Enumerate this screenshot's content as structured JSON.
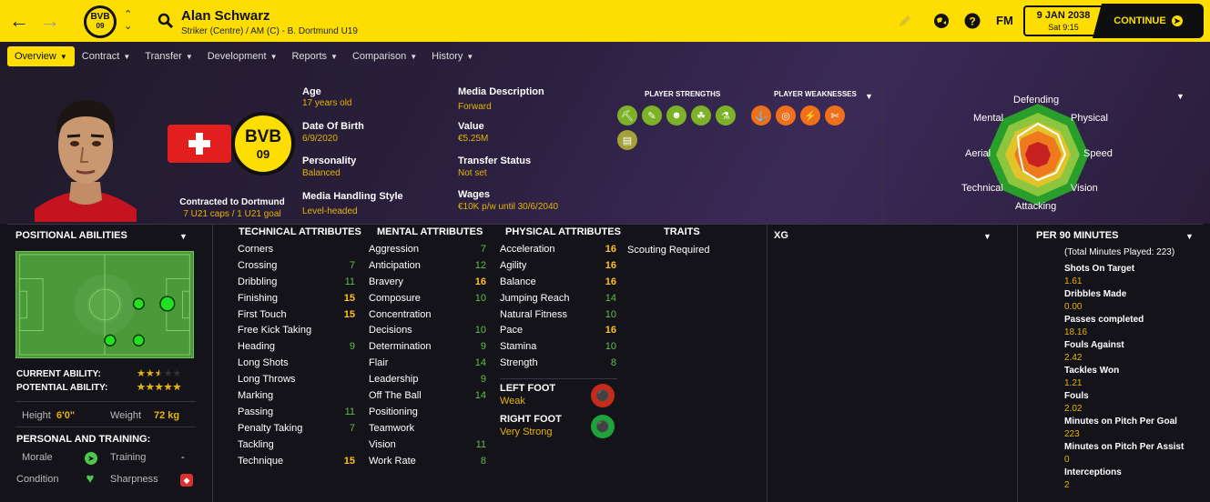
{
  "player": {
    "name": "Alan Schwarz",
    "subtitle": "Striker (Centre) / AM (C) - B. Dortmund U19"
  },
  "club_badge": {
    "top": "BVB",
    "bottom": "09"
  },
  "topbar": {
    "date": "9 JAN 2038",
    "time": "Sat 9:15",
    "continue_label": "CONTINUE",
    "fm_label": "FM"
  },
  "tabs": [
    {
      "label": "Overview"
    },
    {
      "label": "Contract"
    },
    {
      "label": "Transfer"
    },
    {
      "label": "Development"
    },
    {
      "label": "Reports"
    },
    {
      "label": "Comparison"
    },
    {
      "label": "History"
    }
  ],
  "contract": {
    "line1": "Contracted to Dortmund",
    "line2": "7 U21 caps / 1 U21 goal"
  },
  "info": {
    "age_label": "Age",
    "age": "17 years old",
    "dob_label": "Date Of Birth",
    "dob": "6/9/2020",
    "personality_label": "Personality",
    "personality": "Balanced",
    "media_style_label": "Media Handling Style",
    "media_style": "Level-headed",
    "media_desc_label": "Media Description",
    "media_desc": "Forward",
    "value_label": "Value",
    "value": "€5.25M",
    "transfer_label": "Transfer Status",
    "transfer": "Not set",
    "wages_label": "Wages",
    "wages": "€10K p/w until 30/6/2040"
  },
  "strengths_header": "PLAYER STRENGTHS",
  "weaknesses_header": "PLAYER WEAKNESSES",
  "strength_icons": [
    "boot-icon",
    "leg-icon",
    "head-icon",
    "feet-icon",
    "flask-icon",
    "document-icon"
  ],
  "weakness_icons": [
    "whistle-icon",
    "target-icon",
    "leg-strain-icon",
    "ankle-icon"
  ],
  "radar_labels": {
    "defending": "Defending",
    "physical": "Physical",
    "speed": "Speed",
    "vision": "Vision",
    "attacking": "Attacking",
    "technical": "Technical",
    "aerial": "Aerial",
    "mental": "Mental"
  },
  "positional": {
    "header": "POSITIONAL ABILITIES",
    "current_label": "CURRENT ABILITY:",
    "potential_label": "POTENTIAL ABILITY:",
    "current_stars": 2.5,
    "potential_stars": 5,
    "current_stars_text": "★★★★★",
    "potential_stars_text": "★★★★★",
    "height_label": "Height",
    "height": "6'0\"",
    "weight_label": "Weight",
    "weight": "72 kg"
  },
  "training": {
    "header": "PERSONAL AND TRAINING:",
    "morale_label": "Morale",
    "training_label": "Training",
    "training_value": "-",
    "condition_label": "Condition",
    "sharpness_label": "Sharpness"
  },
  "technical": {
    "header": "TECHNICAL ATTRIBUTES",
    "rows": [
      {
        "name": "Corners",
        "value": ""
      },
      {
        "name": "Crossing",
        "value": "7"
      },
      {
        "name": "Dribbling",
        "value": "11"
      },
      {
        "name": "Finishing",
        "value": "15"
      },
      {
        "name": "First Touch",
        "value": "15"
      },
      {
        "name": "Free Kick Taking",
        "value": ""
      },
      {
        "name": "Heading",
        "value": "9"
      },
      {
        "name": "Long Shots",
        "value": ""
      },
      {
        "name": "Long Throws",
        "value": ""
      },
      {
        "name": "Marking",
        "value": ""
      },
      {
        "name": "Passing",
        "value": "11"
      },
      {
        "name": "Penalty Taking",
        "value": "7"
      },
      {
        "name": "Tackling",
        "value": ""
      },
      {
        "name": "Technique",
        "value": "15"
      }
    ]
  },
  "mental": {
    "header": "MENTAL ATTRIBUTES",
    "rows": [
      {
        "name": "Aggression",
        "value": "7"
      },
      {
        "name": "Anticipation",
        "value": "12"
      },
      {
        "name": "Bravery",
        "value": "16"
      },
      {
        "name": "Composure",
        "value": "10"
      },
      {
        "name": "Concentration",
        "value": ""
      },
      {
        "name": "Decisions",
        "value": "10"
      },
      {
        "name": "Determination",
        "value": "9"
      },
      {
        "name": "Flair",
        "value": "14"
      },
      {
        "name": "Leadership",
        "value": "9"
      },
      {
        "name": "Off The Ball",
        "value": "14"
      },
      {
        "name": "Positioning",
        "value": ""
      },
      {
        "name": "Teamwork",
        "value": ""
      },
      {
        "name": "Vision",
        "value": "11"
      },
      {
        "name": "Work Rate",
        "value": "8"
      }
    ]
  },
  "physical": {
    "header": "PHYSICAL ATTRIBUTES",
    "rows": [
      {
        "name": "Acceleration",
        "value": "16"
      },
      {
        "name": "Agility",
        "value": "16"
      },
      {
        "name": "Balance",
        "value": "16"
      },
      {
        "name": "Jumping Reach",
        "value": "14"
      },
      {
        "name": "Natural Fitness",
        "value": "10"
      },
      {
        "name": "Pace",
        "value": "16"
      },
      {
        "name": "Stamina",
        "value": "10"
      },
      {
        "name": "Strength",
        "value": "8"
      }
    ]
  },
  "feet": {
    "left_label": "LEFT FOOT",
    "left": "Weak",
    "right_label": "RIGHT FOOT",
    "right": "Very Strong"
  },
  "traits": {
    "header": "TRAITS",
    "text": "Scouting Required"
  },
  "xg": {
    "header": "XG"
  },
  "per90": {
    "header": "PER 90 MINUTES",
    "total": "(Total Minutes Played: 223)",
    "stats": [
      {
        "label": "Shots On Target",
        "value": "1.61"
      },
      {
        "label": "Dribbles Made",
        "value": "0.00"
      },
      {
        "label": "Passes completed",
        "value": "18.16"
      },
      {
        "label": "Fouls Against",
        "value": "2.42"
      },
      {
        "label": "Tackles Won",
        "value": "1.21"
      },
      {
        "label": "Fouls",
        "value": "2.02"
      },
      {
        "label": "Minutes on Pitch Per Goal",
        "value": "223"
      },
      {
        "label": "Minutes on Pitch Per Assist",
        "value": "0"
      },
      {
        "label": "Interceptions",
        "value": "2"
      }
    ]
  },
  "colors": {
    "accent": "#fdde00",
    "high": "#ffc21a",
    "mid": "#5fbf44",
    "weak": "#ef6f1a"
  }
}
